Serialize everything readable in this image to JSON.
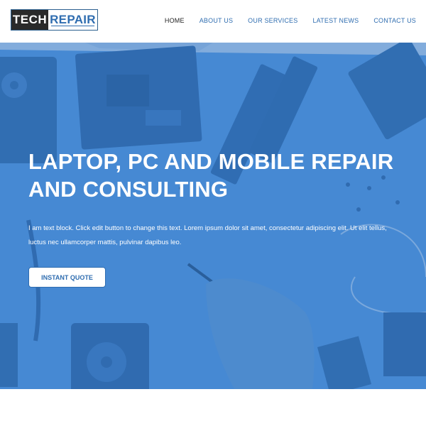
{
  "brand": {
    "logo_left": "TECH",
    "logo_right": "REPAIR"
  },
  "nav": {
    "items": [
      {
        "label": "HOME",
        "active": true
      },
      {
        "label": "ABOUT US",
        "active": false
      },
      {
        "label": "OUR SERVICES",
        "active": false
      },
      {
        "label": "LATEST NEWS",
        "active": false
      },
      {
        "label": "CONTACT US",
        "active": false
      }
    ]
  },
  "hero": {
    "title": "LAPTOP, PC AND MOBILE REPAIR AND CONSULTING",
    "text": "I am text block. Click edit button to change this text. Lorem ipsum dolor sit amet, consectetur adipiscing elit. Ut elit tellus, luctus nec ullamcorper mattis, pulvinar dapibus leo.",
    "button_label": "INSTANT QUOTE"
  },
  "colors": {
    "accent": "#2f6db0",
    "hero_overlay": "#3f86cf",
    "logo_dark": "#2a2a2a"
  }
}
